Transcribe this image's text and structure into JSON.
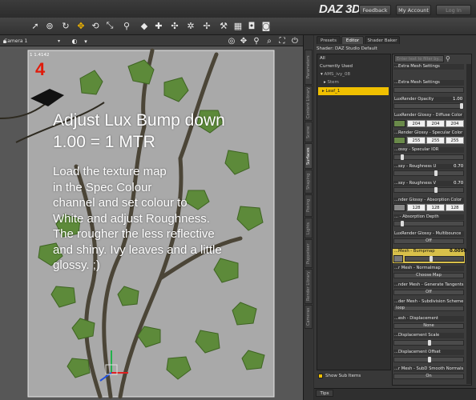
{
  "header": {
    "logo": "DAZ 3D",
    "buttons": [
      "Feedback",
      "My Account",
      "Log In"
    ]
  },
  "toolbar": {
    "icons": [
      "arrow-select-icon",
      "node-selection-icon",
      "universal-tool-icon",
      "translate-tool-icon",
      "rotate-tool-icon",
      "scale-tool-icon",
      "joint-editor-icon",
      "surface-selection-icon",
      "region-navigator-icon",
      "geometry-editor-icon",
      "spot-render-icon",
      "node-weight-brush-icon",
      "render-settings-icon",
      "render-icon",
      "render-library-icon"
    ]
  },
  "viewport": {
    "camera": "Camera 1",
    "zoom_readout": "1  1.4142",
    "step_number": "4",
    "headline_lines": [
      "Adjust Lux Bump down",
      "1.00 = 1 MTR"
    ],
    "body_lines": [
      "Load the texture map",
      "in the Spec Colour",
      "channel and set colour to",
      "White and adjust Roughness.",
      "The rougher the less reflective",
      "and shiny. Ivy leaves and a little",
      "glossy. ;)"
    ]
  },
  "side_tabs": [
    "Parameters",
    "Content Library",
    "Scene",
    "Surfaces",
    "Shaping",
    "Posing",
    "Lights",
    "Puppeteer",
    "Render Library",
    "Cameras"
  ],
  "panel": {
    "tabs": [
      "Presets",
      "Editor",
      "Shader Baker"
    ],
    "active_tab": "Editor",
    "shader_label": "Shader: DAZ Studio Default",
    "tree": {
      "items": [
        "All",
        "Currently Used",
        "AMS_ivy_08",
        "Stem",
        "Leaf_1"
      ],
      "selected": "Leaf_1"
    },
    "filter_placeholder": "Enter text to filter by...",
    "properties": {
      "extra_mesh_settings": "...Extra Mesh Settings",
      "luxrender_opacity": {
        "label": "LuxRender Opacity",
        "value": "1.00"
      },
      "diffuse_color": {
        "label": "LuxRender Glossy - Diffuse Color",
        "r": "204",
        "g": "204",
        "b": "204"
      },
      "specular_color": {
        "label": "...Render Glossy - Specular Color",
        "r": "255",
        "g": "255",
        "b": "255"
      },
      "specular_ior": {
        "label": "...ossy - Specular IOR"
      },
      "roughness_u": {
        "label": "...ssy - Roughness U",
        "value": "0.70"
      },
      "roughness_v": {
        "label": "...ssy - Roughness V",
        "value": "0.70"
      },
      "absorption_color": {
        "label": "...nder Glossy - Absorption Color",
        "r": "128",
        "g": "128",
        "b": "128"
      },
      "absorption_depth": {
        "label": "... - Absorption Depth"
      },
      "multibounce": {
        "label": "LuxRender Glossy - Multibounce",
        "value": "Off"
      },
      "bumpmap": {
        "label": "...Mesh - Bumpmap",
        "value": "0.0050"
      },
      "normalmap": {
        "label": "...r Mesh - Normalmap",
        "value": "Choose Map"
      },
      "generate_tangents": {
        "label": "...nder Mesh - Generate Tangents",
        "value": "Off"
      },
      "subdivision_scheme": {
        "label": "...der Mesh - Subdivision Scheme",
        "value": "loop"
      },
      "displacement": {
        "label": "...esh - Displacement",
        "value": "None"
      },
      "displacement_scale": {
        "label": "...Displacement Scale"
      },
      "displacement_offset": {
        "label": "...Displacement Offset"
      },
      "subd_smooth_normals": {
        "label": "...r Mesh - SubD Smooth Normals",
        "value": "On"
      }
    },
    "show_sub_items": "Show Sub Items",
    "tips": "Tips"
  }
}
